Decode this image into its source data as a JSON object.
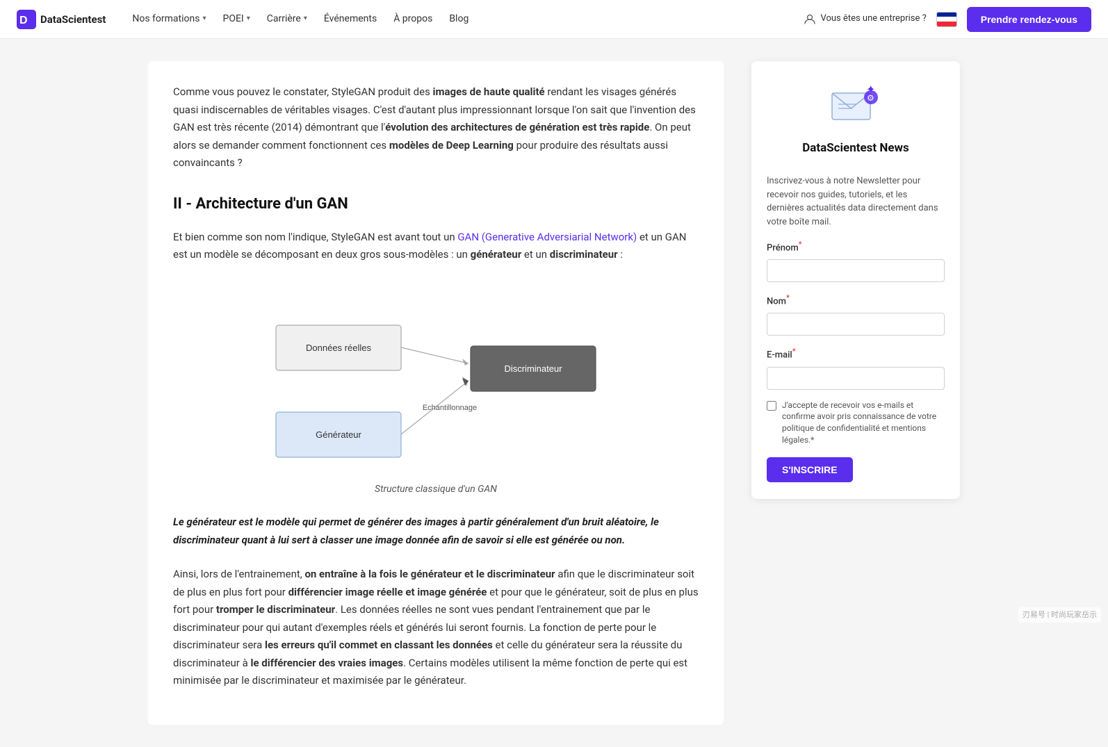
{
  "nav": {
    "logo_text": "DataScientest",
    "links": [
      {
        "label": "Nos formations",
        "has_dropdown": true
      },
      {
        "label": "POEI",
        "has_dropdown": true
      },
      {
        "label": "Carrière",
        "has_dropdown": true
      },
      {
        "label": "Événements",
        "has_dropdown": false
      },
      {
        "label": "À propos",
        "has_dropdown": false
      },
      {
        "label": "Blog",
        "has_dropdown": false
      }
    ],
    "enterprise_label": "Vous êtes une entreprise ?",
    "rdv_button": "Prendre rendez-vous"
  },
  "article": {
    "para1_text_before_bold": "Comme vous pouvez le constater, StyleGAN produit des ",
    "para1_bold": "images de haute qualité",
    "para1_text_after_bold": " rendant les visages générés quasi indiscernables de véritables visages. C'est d'autant plus impressionnant lorsque l'on sait que l'invention des GAN est très récente (2014) démontrant que l'",
    "para1_bold2": "évolution des architectures de génération est très rapide",
    "para1_text_end": ". On peut alors se demander comment fonctionnent ces ",
    "para1_bold3": "modèles de Deep Learning",
    "para1_text_last": " pour produire des résultats aussi convaincants ?",
    "section_title": "II - Architecture d'un GAN",
    "para2_text_before_link": "Et bien comme son nom l'indique, StyleGAN est avant tout un ",
    "para2_link_text": "GAN (Generative Adversiarial Network)",
    "para2_text_after_link": " et un GAN est un modèle se décomposant en deux gros sous-modèles : un ",
    "para2_bold1": "générateur",
    "para2_text_mid": " et un ",
    "para2_bold2": "discriminateur",
    "para2_text_end": " :",
    "diagram_caption": "Structure classique d'un GAN",
    "diagram_labels": {
      "donnees": "Données réelles",
      "generateur": "Générateur",
      "echantillonnage": "Echantillonnage",
      "discriminateur": "Discriminateur"
    },
    "blockquote": "Le générateur est le modèle qui permet de générer des images à partir généralement d'un bruit aléatoire, le discriminateur quant à lui sert à classer une image donnée afin de savoir si elle est générée ou non.",
    "para3_text_before_bold": "Ainsi, lors de l'entrainement, ",
    "para3_bold1": "on entraîne à la fois le générateur et le discriminateur",
    "para3_text1": " afin que le discriminateur soit de plus en plus fort pour ",
    "para3_bold2": "différencier image réelle et image générée",
    "para3_text2": " et pour que le générateur, soit de plus en plus fort pour ",
    "para3_bold3": "tromper le discriminateur",
    "para3_text3": ". Les données réelles ne sont vues pendant l'entrainement que par le discriminateur pour qui autant d'exemples réels et générés lui seront fournis. La fonction de perte pour le discriminateur sera ",
    "para3_bold4": "les erreurs qu'il commet en classant les données",
    "para3_text4": " et celle du générateur sera la réussite du discriminateur à ",
    "para3_bold5": "le différencier des vraies images",
    "para3_text5": ". Certains modèles utilisent la même fonction de perte qui est minimisée par le discriminateur et maximisée par le générateur."
  },
  "sidebar": {
    "card_title": "DataScientest News",
    "card_desc": "Inscrivez-vous à notre Newsletter pour recevoir nos guides, tutoriels, et les dernières actualités data directement dans votre boîte mail.",
    "prenom_label": "Prénom",
    "nom_label": "Nom",
    "email_label": "E-mail",
    "checkbox_text": "J'accepte de recevoir vos e-mails et confirme avoir pris connaissance de votre politique de confidentialité et mentions légales.*",
    "subscribe_button": "S'INSCRIRE"
  },
  "watermark": "刃易号 | 时尚玩家岳示"
}
